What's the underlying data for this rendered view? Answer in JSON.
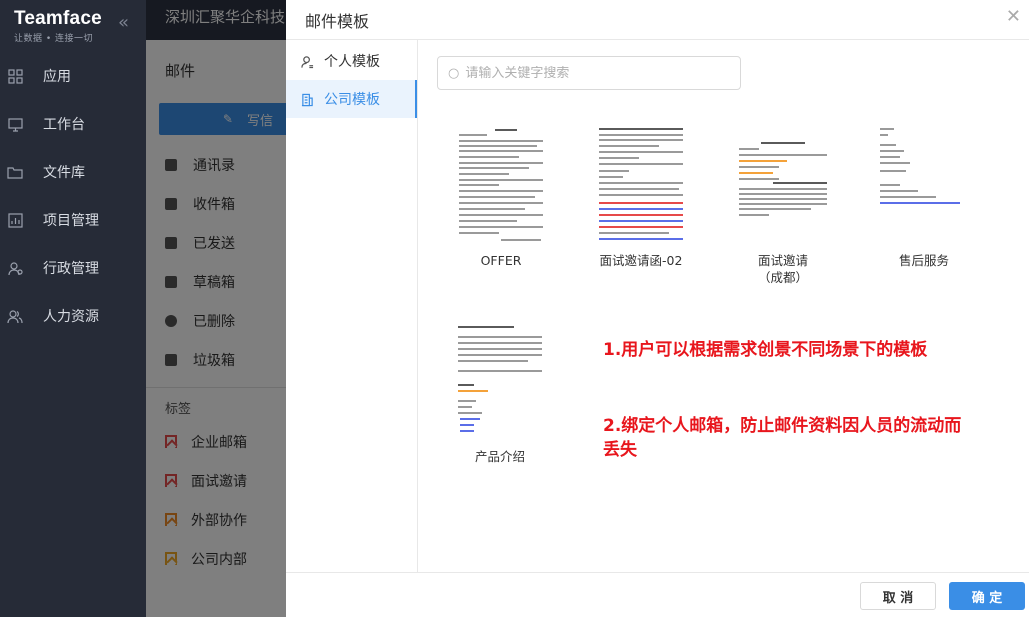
{
  "app": {
    "logo_title": "Teamface",
    "logo_subtitle": "让数据 • 连接一切",
    "company": "深圳汇聚华企科技"
  },
  "sidebar": {
    "items": [
      {
        "label": "应用",
        "icon": "apps-icon"
      },
      {
        "label": "工作台",
        "icon": "monitor-icon"
      },
      {
        "label": "文件库",
        "icon": "folder-icon"
      },
      {
        "label": "项目管理",
        "icon": "project-icon"
      },
      {
        "label": "行政管理",
        "icon": "admin-icon"
      },
      {
        "label": "人力资源",
        "icon": "people-icon"
      }
    ]
  },
  "mail": {
    "title": "邮件",
    "compose_label": "写信",
    "folders": [
      {
        "label": "通讯录",
        "icon": "contacts-icon"
      },
      {
        "label": "收件箱",
        "icon": "inbox-icon"
      },
      {
        "label": "已发送",
        "icon": "sent-icon"
      },
      {
        "label": "草稿箱",
        "icon": "drafts-icon"
      },
      {
        "label": "已删除",
        "icon": "deleted-icon"
      },
      {
        "label": "垃圾箱",
        "icon": "trash-icon"
      }
    ],
    "tags_title": "标签",
    "tags": [
      {
        "label": "企业邮箱",
        "color": "#e64a4a"
      },
      {
        "label": "面试邀请",
        "color": "#e64a4a"
      },
      {
        "label": "外部协作",
        "color": "#f08a24"
      },
      {
        "label": "公司内部",
        "color": "#f0a824"
      }
    ]
  },
  "modal": {
    "title": "邮件模板",
    "tabs": [
      {
        "label": "个人模板",
        "active": false,
        "icon": "user-icon"
      },
      {
        "label": "公司模板",
        "active": true,
        "icon": "building-icon"
      }
    ],
    "search_placeholder": "请输入关键字搜索",
    "templates": [
      {
        "name": "OFFER"
      },
      {
        "name": "面试邀请函-02"
      },
      {
        "name": "面试邀请（成都）"
      },
      {
        "name": "售后服务"
      },
      {
        "name": "产品介绍"
      }
    ],
    "notes": [
      "1.用户可以根据需求创景不同场景下的模板",
      "2.绑定个人邮箱，防止邮件资料因人员的流动而丢失"
    ],
    "cancel_label": "取 消",
    "ok_label": "确 定"
  },
  "colors": {
    "accent": "#3a8ee6",
    "sidebar_bg": "#262b37",
    "note": "#e8161d"
  }
}
